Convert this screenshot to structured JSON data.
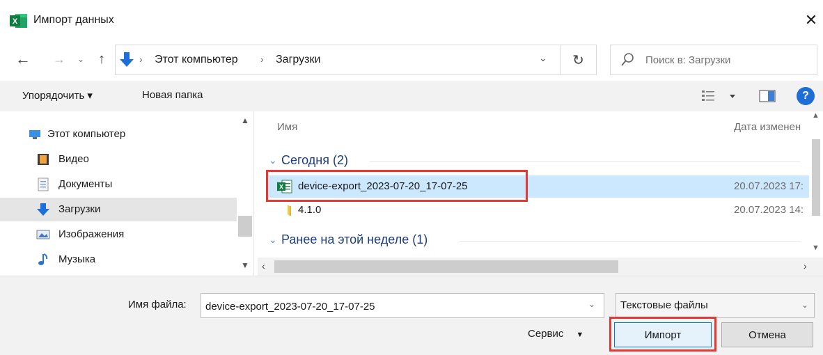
{
  "window": {
    "title": "Импорт данных",
    "close_glyph": "✕",
    "app_icon": "excel-icon"
  },
  "nav": {
    "back_glyph": "←",
    "forward_glyph": "→",
    "recent_glyph": "⌄",
    "up_glyph": "↑",
    "refresh_glyph": "↻",
    "dropdown_glyph": "⌄"
  },
  "address": {
    "segments": [
      "Этот компьютер",
      "Загрузки"
    ],
    "separator": "›"
  },
  "search": {
    "placeholder": "Поиск в: Загрузки"
  },
  "toolbar": {
    "organize_label": "Упорядочить ▾",
    "new_folder_label": "Новая папка",
    "help_glyph": "?"
  },
  "sidebar": {
    "items": [
      {
        "label": "Этот компьютер",
        "icon": "computer-icon"
      },
      {
        "label": "Видео",
        "icon": "video-folder-icon"
      },
      {
        "label": "Документы",
        "icon": "documents-folder-icon"
      },
      {
        "label": "Загрузки",
        "icon": "downloads-folder-icon",
        "selected": true
      },
      {
        "label": "Изображения",
        "icon": "pictures-folder-icon"
      },
      {
        "label": "Музыка",
        "icon": "music-folder-icon"
      }
    ]
  },
  "filelist": {
    "columns": {
      "name": "Имя",
      "date": "Дата изменен"
    },
    "groups": [
      {
        "label": "Сегодня (2)",
        "files": [
          {
            "name": "device-export_2023-07-20_17-07-25",
            "date": "20.07.2023 17:",
            "icon": "excel-file-icon",
            "selected": true
          },
          {
            "name": "4.1.0",
            "date": "20.07.2023 14:",
            "icon": "folder-icon",
            "selected": false
          }
        ]
      },
      {
        "label": "Ранее на этой неделе (1)",
        "files": []
      }
    ]
  },
  "bottom": {
    "filename_label": "Имя файла:",
    "filename_value": "device-export_2023-07-20_17-07-25",
    "filetype_value": "Текстовые файлы",
    "service_label": "Сервис",
    "import_label": "Импорт",
    "cancel_label": "Отмена"
  },
  "colors": {
    "highlight": "#e53935",
    "selection": "#cce8ff",
    "accent": "#0078d7"
  }
}
